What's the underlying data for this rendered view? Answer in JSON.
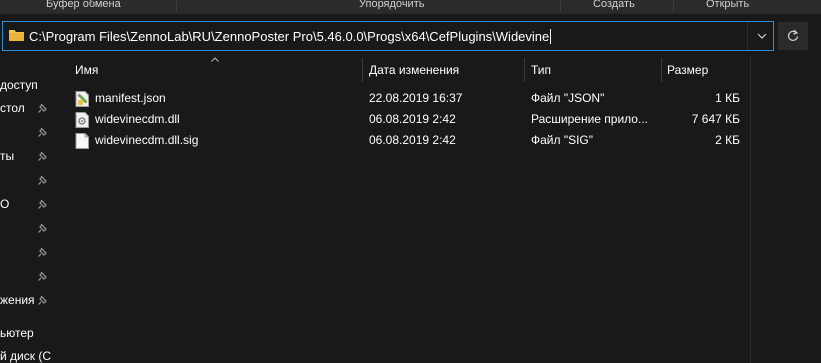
{
  "ribbon": {
    "clipboard": "Буфер обмена",
    "organize": "Упорядочить",
    "create": "Создать",
    "open": "Открыть"
  },
  "address": {
    "path": "C:\\Program Files\\ZennoLab\\RU\\ZennoPoster Pro\\5.46.0.0\\Progs\\x64\\CefPlugins\\Widevine"
  },
  "nav": {
    "items": [
      {
        "label": "доступ",
        "pinned": false
      },
      {
        "label": "стол",
        "pinned": true
      },
      {
        "label": "",
        "pinned": true
      },
      {
        "label": "ты",
        "pinned": true
      },
      {
        "label": "",
        "pinned": true
      },
      {
        "label": "О",
        "pinned": true
      },
      {
        "label": "",
        "pinned": true
      },
      {
        "label": "",
        "pinned": true
      },
      {
        "label": "",
        "pinned": true
      },
      {
        "label": "жения",
        "pinned": true
      },
      {
        "label": "ьютер",
        "pinned": false
      },
      {
        "label": "й диск (С",
        "pinned": false
      }
    ]
  },
  "columns": {
    "name": "Имя",
    "date": "Дата изменения",
    "type": "Тип",
    "size": "Размер"
  },
  "files": [
    {
      "name": "manifest.json",
      "date": "22.08.2019 16:37",
      "type": "Файл \"JSON\"",
      "size": "1 КБ",
      "icon": "json-file-icon"
    },
    {
      "name": "widevinecdm.dll",
      "date": "06.08.2019 2:42",
      "type": "Расширение прило...",
      "size": "7 647 КБ",
      "icon": "dll-file-icon"
    },
    {
      "name": "widevinecdm.dll.sig",
      "date": "06.08.2019 2:42",
      "type": "Файл \"SIG\"",
      "size": "2 КБ",
      "icon": "generic-file-icon"
    }
  ],
  "colors": {
    "background": "#191919",
    "accent": "#2e8cd6",
    "folder": "#f4c54a"
  }
}
